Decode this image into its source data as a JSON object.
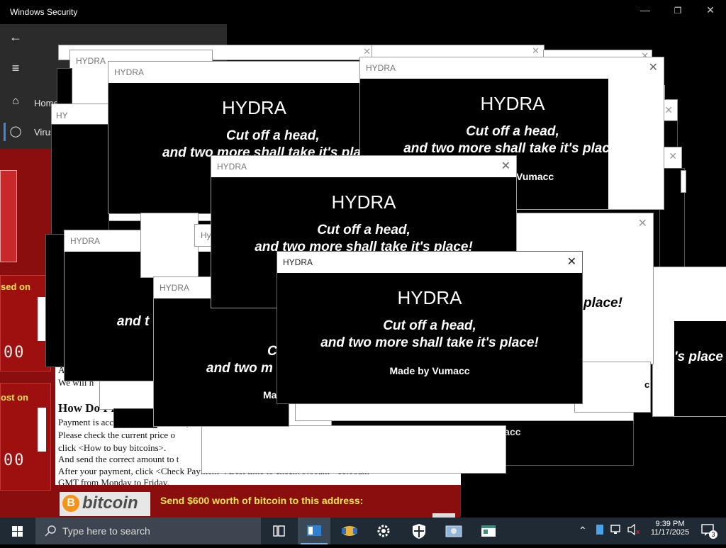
{
  "background_window": {
    "title": "Windows Security",
    "nav": {
      "back_icon": "back-arrow-icon",
      "menu_icon": "hamburger-icon",
      "items": [
        {
          "label": "Home",
          "icon": "home-icon"
        },
        {
          "label": "Virus & threat protection",
          "icon": "shield-icon"
        }
      ]
    }
  },
  "ransom": {
    "payment_raised_label": "Payment will be raised on",
    "files_lost_label": "Your files will be lost on",
    "timer_1": "00",
    "timer_2": "00",
    "text_a": "A",
    "text_b": "We will h",
    "how_do_i_pay": "How Do I Pay?",
    "line_1": "Payment is accepted in Bitcoin only.",
    "line_2": "Please check the current price o",
    "line_3": "click <How to buy bitcoins>.",
    "line_4": "And send the correct amount to t",
    "line_5": "After your payment, click <Check Payment>. Best time to check: 9:00am - 11:00am",
    "line_6": "GMT from Monday to Friday.",
    "bitcoin_word": "bitcoin",
    "send_text": "Send $600 worth of bitcoin to this address:",
    "colors": {
      "panel": "#8b0e0e",
      "highlight": "#f6e64a"
    }
  },
  "popup": {
    "title": "HYDRA",
    "heading": "HYDRA",
    "line1": "Cut off a head,",
    "line2": "and two more shall take it's place!",
    "credit": "Made by Vumacc",
    "close_icon": "close-icon",
    "fragments": {
      "and_t": "and t",
      "and_two_m": "and two m",
      "c": "C",
      "ma": "Ma",
      "place_excl": "place!",
      "s_place": "'s place",
      "c_small": "c",
      "made_by_partial": "Made by Vumacc",
      "cut_off_partial": "Cut off a head,",
      "and_two_partial": "and two more shall take it's pla",
      "vumacc": "Vumacc",
      "hy": "HY",
      "hy2": "Hy"
    }
  },
  "taskbar": {
    "search_placeholder": "Type here to search",
    "time": "9:39 PM",
    "date": "11/17/2025",
    "notification_count": "3",
    "apps": [
      "task-view-icon",
      "security-app-icon",
      "handshake-icon",
      "settings-icon",
      "shield-app-icon",
      "image-viewer-icon",
      "window-app-icon"
    ]
  }
}
